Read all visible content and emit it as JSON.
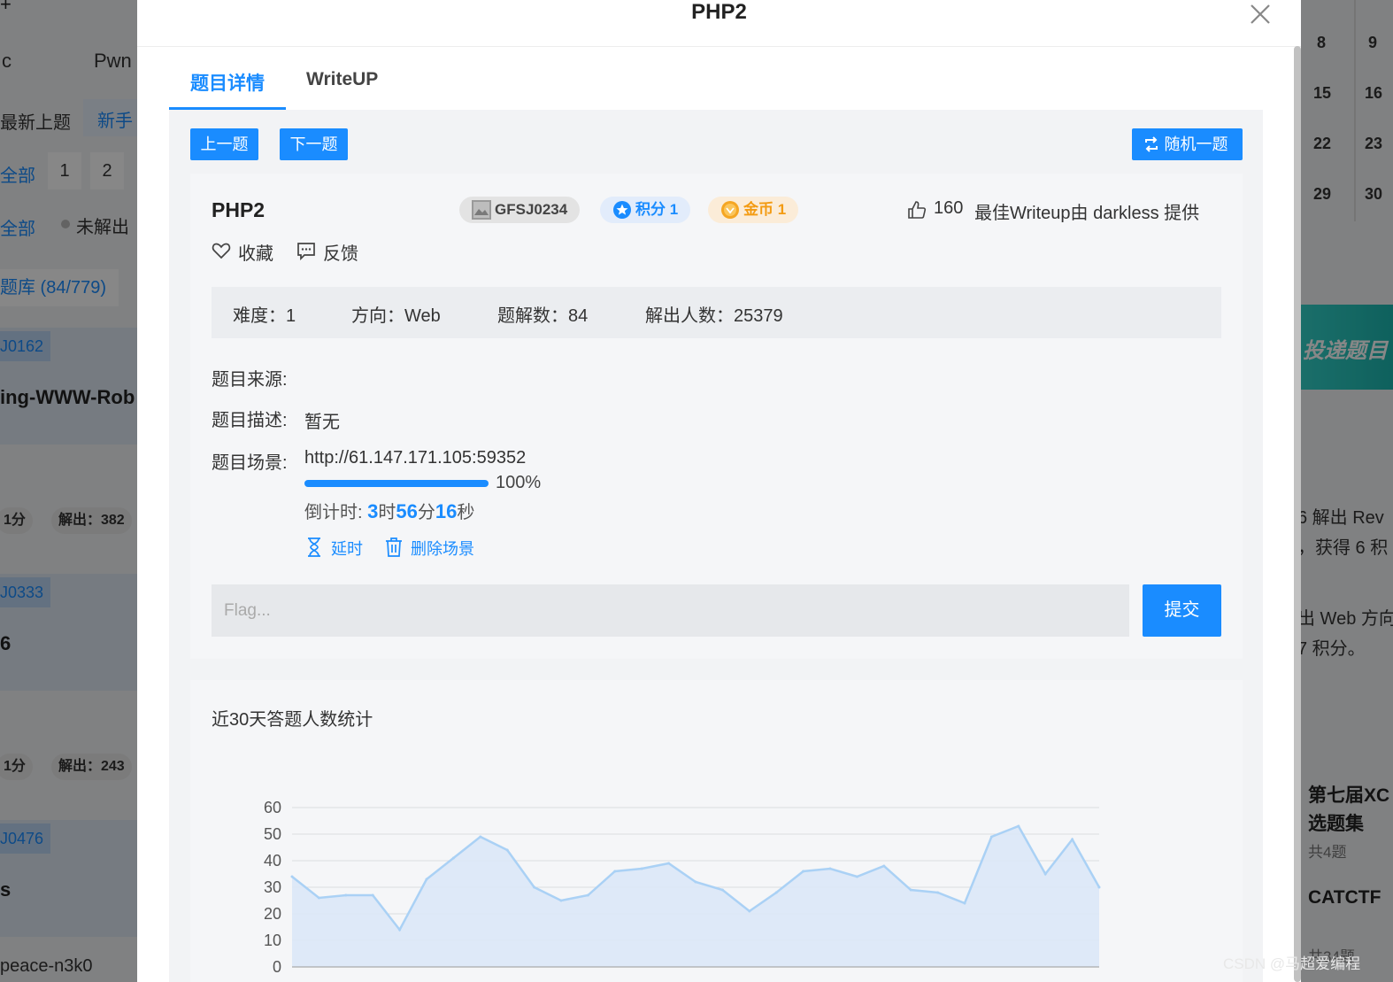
{
  "background": {
    "left": {
      "top_symbol": "+",
      "category_c": "c",
      "category_pwn": "Pwn",
      "filter_latest": "最新上题",
      "filter_newbie": "新手",
      "all_label_1": "全部",
      "page_1": "1",
      "page_2": "2",
      "all_label_2": "全部",
      "status_unsolved": "未解出",
      "bank_label": "题库 (84/779)",
      "cards": [
        {
          "tag": "J0162",
          "title": "ing-WWW-Rob",
          "points": "1分",
          "solved": "解出：382"
        },
        {
          "tag": "J0333",
          "title": "6",
          "points": "1分",
          "solved": "解出：243"
        },
        {
          "tag": "J0476",
          "title": "s",
          "points": "",
          "solved": ""
        }
      ],
      "footer_user": "peace-n3k0"
    },
    "right": {
      "calendar_days": [
        "8",
        "9",
        "15",
        "16",
        "22",
        "23",
        "29",
        "30"
      ],
      "banner_text": "投递题目",
      "news_line_1": "6 解出 Rev",
      "news_line_2": "，获得 6 积",
      "news_line_3": "出 Web 方向",
      "news_line_4": "7 积分。",
      "collection_title_1": "第七届XC",
      "collection_title_2": "选题集",
      "collection_count": "共4题",
      "collection_title_3": "CATCTF",
      "collection_count_2": "共34题"
    }
  },
  "modal": {
    "title": "PHP2",
    "tabs": [
      {
        "label": "题目详情",
        "active": true
      },
      {
        "label": "WriteUP",
        "active": false
      }
    ],
    "buttons": {
      "prev": "上一题",
      "next": "下一题",
      "random": "随机一题",
      "submit": "提交"
    },
    "problem": {
      "name": "PHP2",
      "id_badge": "GFSJ0234",
      "score_badge": "积分 1",
      "coin_badge": "金币 1",
      "likes": "160",
      "best_writeup": "最佳Writeup由 darkless 提供",
      "favorite": "收藏",
      "feedback": "反馈",
      "difficulty": "难度：1",
      "direction": "方向：Web",
      "writeup_count": "题解数：84",
      "solver_count": "解出人数：25379",
      "source_label": "题目来源:",
      "source_value": "",
      "desc_label": "题目描述:",
      "desc_value": "暂无",
      "scene_label": "题目场景:",
      "scene_url": "http://61.147.171.105:59352",
      "progress_percent": 100,
      "progress_text": "100%",
      "countdown_prefix": "倒计时: ",
      "countdown_hours": "3",
      "countdown_h_unit": "时",
      "countdown_minutes": "56",
      "countdown_m_unit": "分",
      "countdown_seconds": "16",
      "countdown_s_unit": "秒",
      "extend": "延时",
      "delete_scene": "删除场景",
      "flag_placeholder": "Flag..."
    },
    "stats_title": "近30天答题人数统计"
  },
  "chart_data": {
    "type": "area",
    "title": "近30天答题人数统计",
    "xlabel": "",
    "ylabel": "",
    "ylim": [
      0,
      60
    ],
    "yticks": [
      "0",
      "10",
      "20",
      "30",
      "40",
      "50",
      "60"
    ],
    "grid": true,
    "series": [
      {
        "values": [
          34,
          26,
          27,
          27,
          14,
          33,
          41,
          49,
          44,
          30,
          25,
          27,
          36,
          37,
          39,
          32,
          29,
          21,
          28,
          36,
          37,
          34,
          38,
          29,
          28,
          24,
          49,
          53,
          35,
          48,
          30
        ]
      }
    ],
    "colors": {
      "line": "#aad1f5",
      "fill": "#dbe8f7"
    }
  },
  "watermark": "CSDN @马超爱编程"
}
